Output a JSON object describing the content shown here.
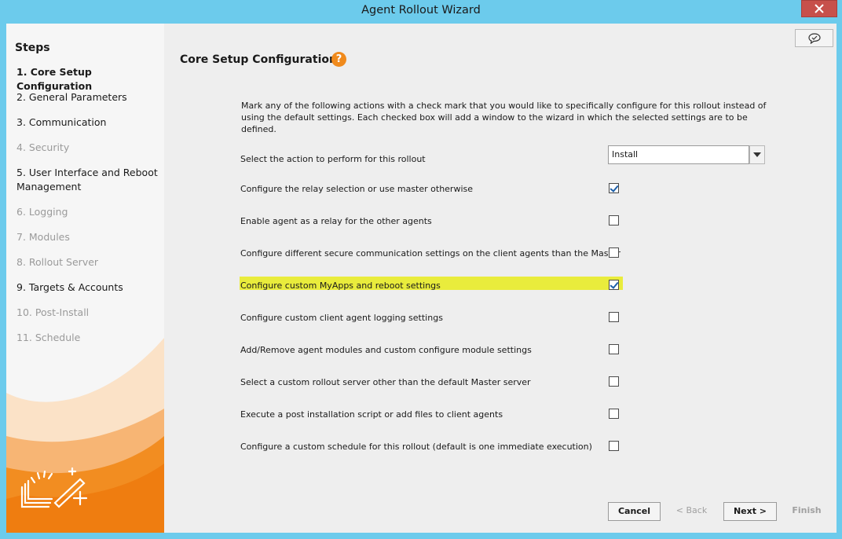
{
  "window": {
    "title": "Agent Rollout Wizard"
  },
  "sidebar": {
    "title": "Steps",
    "steps": [
      {
        "label": "1. Core Setup Configuration",
        "state": "active"
      },
      {
        "label": "2. General Parameters",
        "state": "enabled"
      },
      {
        "label": "3. Communication",
        "state": "enabled"
      },
      {
        "label": "4. Security",
        "state": "disabled"
      },
      {
        "label": "5. User Interface and Reboot Management",
        "state": "enabled"
      },
      {
        "label": "6. Logging",
        "state": "disabled"
      },
      {
        "label": "7. Modules",
        "state": "disabled"
      },
      {
        "label": "8. Rollout Server",
        "state": "disabled"
      },
      {
        "label": "9. Targets & Accounts",
        "state": "enabled"
      },
      {
        "label": "10. Post-Install",
        "state": "disabled"
      },
      {
        "label": "11. Schedule",
        "state": "disabled"
      }
    ]
  },
  "main": {
    "title": "Core Setup Configuration",
    "help_icon": "?",
    "description": "Mark any of the following actions with a check mark that you would like to specifically configure for this rollout instead of using the default settings. Each checked box will add a window to the wizard in which the selected settings are to be defined.",
    "action_select": {
      "label": "Select the action to perform for this rollout",
      "value": "Install"
    },
    "options": [
      {
        "label": "Configure the relay selection or use master otherwise",
        "checked": true,
        "highlighted": false
      },
      {
        "label": "Enable agent as a relay for the other agents",
        "checked": false,
        "highlighted": false
      },
      {
        "label": "Configure different secure communication settings on the client agents than the Master",
        "checked": false,
        "highlighted": false
      },
      {
        "label": "Configure custom MyApps and reboot settings",
        "checked": true,
        "highlighted": true
      },
      {
        "label": "Configure custom client agent logging settings",
        "checked": false,
        "highlighted": false
      },
      {
        "label": "Add/Remove agent modules and custom configure module settings",
        "checked": false,
        "highlighted": false
      },
      {
        "label": "Select a custom rollout server other than the default Master server",
        "checked": false,
        "highlighted": false
      },
      {
        "label": "Execute a post installation script or add files to client agents",
        "checked": false,
        "highlighted": false
      },
      {
        "label": "Configure a custom schedule for this rollout (default is one immediate execution)",
        "checked": false,
        "highlighted": false
      }
    ]
  },
  "footer": {
    "cancel": "Cancel",
    "back": "< Back",
    "next": "Next >",
    "finish": "Finish"
  },
  "icons": {
    "close": "close-icon",
    "feedback": "feedback-icon",
    "dropdown": "chevron-down-icon",
    "logo": "wand-logo"
  },
  "colors": {
    "titlebar": "#6ccbec",
    "accent_orange": "#f08a1c",
    "close_red": "#c7504b",
    "highlight_yellow": "#e9ec3c",
    "check_blue": "#1d5fa8"
  }
}
